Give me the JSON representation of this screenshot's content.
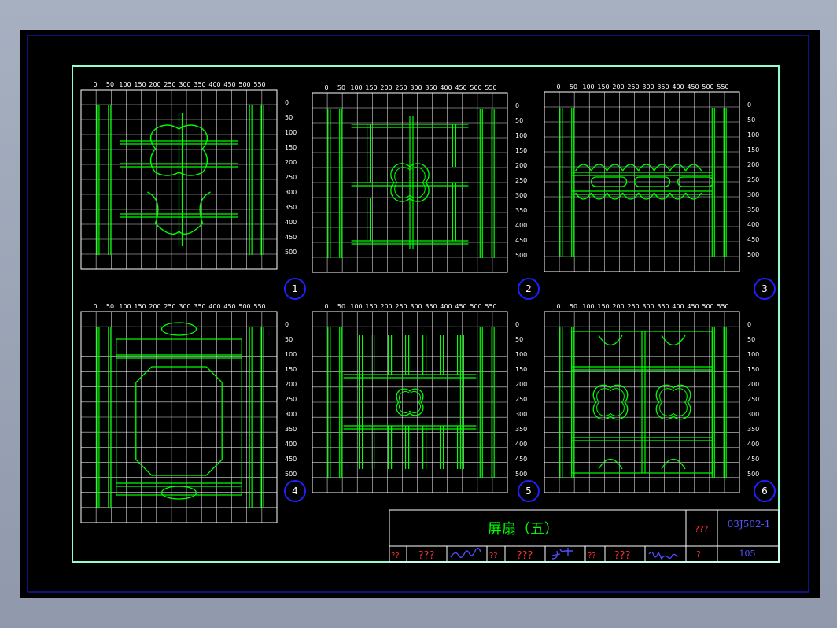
{
  "viewport": {
    "background": "#000000",
    "frame_color": "#0000ff",
    "sheet_border_color": "#8fffd0",
    "grid_color": "#ffffff",
    "pattern_color": "#00ff00",
    "accent_color": "#0000ff"
  },
  "panels": [
    {
      "number": "1"
    },
    {
      "number": "2"
    },
    {
      "number": "3"
    },
    {
      "number": "4"
    },
    {
      "number": "5"
    },
    {
      "number": "6"
    }
  ],
  "top_ticks": [
    "0",
    "50",
    "100",
    "150",
    "200",
    "250",
    "300",
    "350",
    "400",
    "450",
    "500",
    "550"
  ],
  "side_ticks": [
    "0",
    "50",
    "100",
    "150",
    "200",
    "250",
    "300",
    "350",
    "400",
    "450",
    "500"
  ],
  "title_block": {
    "title": "屏扇（五）",
    "code_label": "???",
    "code": "03J502-1",
    "page_label": "?",
    "page": "105",
    "row": [
      "??",
      "???",
      "??",
      "???",
      "??",
      "???"
    ]
  }
}
